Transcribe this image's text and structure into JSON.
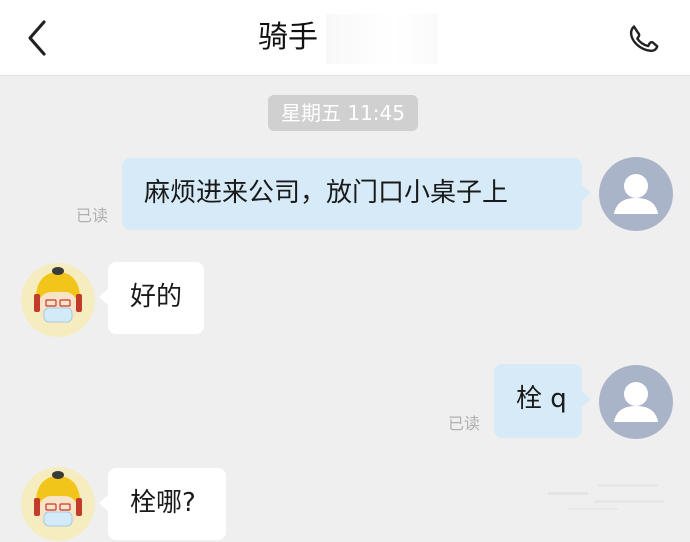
{
  "header": {
    "title": "骑手",
    "back_icon": "chevron-left-icon",
    "call_icon": "phone-icon"
  },
  "timestamp": "星期五 11:45",
  "messages": [
    {
      "direction": "out",
      "text": "麻烦进来公司，放门口小桌子上",
      "read_status": "已读"
    },
    {
      "direction": "in",
      "text": "好的"
    },
    {
      "direction": "out",
      "text": "栓 q",
      "read_status": "已读"
    },
    {
      "direction": "in",
      "text": "栓哪?"
    }
  ],
  "colors": {
    "background": "#efefef",
    "outgoing_bubble": "#d6ebf7",
    "incoming_bubble": "#ffffff",
    "avatar_default": "#aab4c8"
  }
}
